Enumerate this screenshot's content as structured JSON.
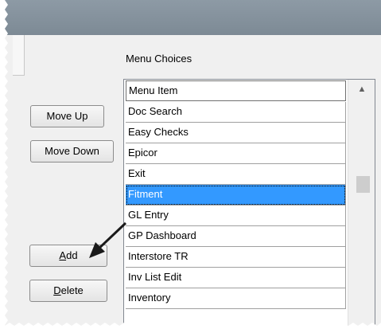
{
  "panel": {
    "title": "Menu Choices"
  },
  "buttons": {
    "move_up": "Move Up",
    "move_down": "Move Down",
    "add_accel": "A",
    "add_rest": "dd",
    "delete_accel": "D",
    "delete_rest": "elete"
  },
  "list": {
    "header": "Menu Item",
    "items": [
      "Doc Search",
      "Easy Checks",
      "Epicor",
      "Exit",
      "Fitment",
      "GL Entry",
      "GP Dashboard",
      "Interstore TR",
      "Inv List Edit",
      "Inventory"
    ],
    "selected_item": "Fitment"
  },
  "scrollbar": {
    "up_icon": "triangle-up"
  },
  "colors": {
    "titlebar": "#8593a0",
    "selection": "#3399ff",
    "window": "#f0f0f0"
  }
}
